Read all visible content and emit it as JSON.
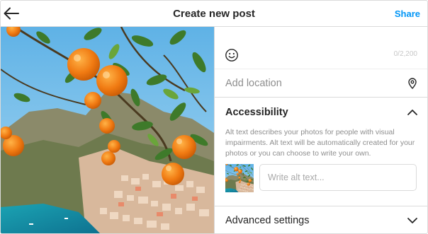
{
  "header": {
    "title": "Create new post",
    "share_label": "Share",
    "back_icon": "arrow-left-icon"
  },
  "post_image": {
    "subject": "orange tree branches over a cliffside coastal town and turquoise sea"
  },
  "caption": {
    "emoji_icon": "smiley-icon",
    "counter": "0/2,200"
  },
  "location": {
    "label": "Add location",
    "icon": "location-pin-icon"
  },
  "accessibility": {
    "title": "Accessibility",
    "description": "Alt text describes your photos for people with visual impairments. Alt text will be automatically created for your photos or you can choose to write your own.",
    "alt_placeholder": "Write alt text...",
    "alt_value": "",
    "expanded_icon": "chevron-up-icon"
  },
  "advanced": {
    "label": "Advanced settings",
    "icon": "chevron-down-icon"
  },
  "colors": {
    "accent": "#0095f6",
    "border": "#dbdbdb",
    "text": "#262626",
    "muted": "#8e8e8e"
  }
}
